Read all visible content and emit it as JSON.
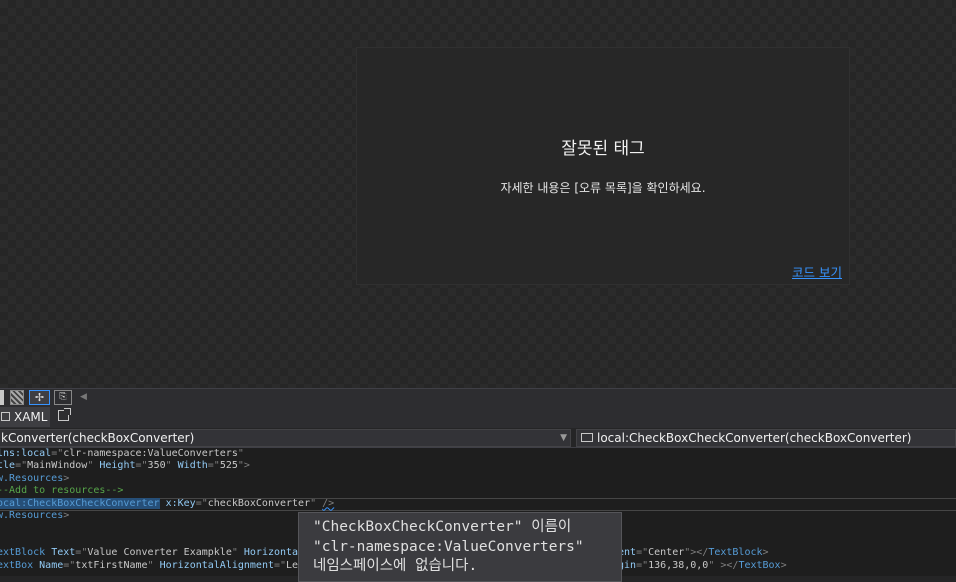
{
  "designer": {
    "error_title": "잘못된 태그",
    "error_message": "자세한 내용은 [오류 목록]을 확인하세요.",
    "view_code_link": "코드 보기"
  },
  "tabs": {
    "xaml_label": "XAML"
  },
  "navigation": {
    "left_combo": "kConverter(checkBoxConverter)",
    "right_combo": "local:CheckBoxCheckConverter(checkBoxConverter)"
  },
  "code_lines": [
    [
      {
        "c": "attr",
        "t": "lns:"
      },
      {
        "c": "attr",
        "t": "local"
      },
      {
        "c": "pct",
        "t": "=\""
      },
      {
        "c": "val",
        "t": "clr-namespace:ValueConverters"
      },
      {
        "c": "pct",
        "t": "\""
      }
    ],
    [
      {
        "c": "attr",
        "t": "tle"
      },
      {
        "c": "pct",
        "t": "=\""
      },
      {
        "c": "val",
        "t": "MainWindow"
      },
      {
        "c": "pct",
        "t": "\" "
      },
      {
        "c": "attr",
        "t": "Height"
      },
      {
        "c": "pct",
        "t": "=\""
      },
      {
        "c": "val",
        "t": "350"
      },
      {
        "c": "pct",
        "t": "\" "
      },
      {
        "c": "attr",
        "t": "Width"
      },
      {
        "c": "pct",
        "t": "=\""
      },
      {
        "c": "val",
        "t": "525"
      },
      {
        "c": "pct",
        "t": "\">"
      }
    ],
    [
      {
        "c": "el",
        "t": "w.Resources"
      },
      {
        "c": "pct",
        "t": ">"
      }
    ],
    [
      {
        "c": "cm",
        "t": "--Add to resources-->"
      }
    ],
    [
      {
        "c": "el sel",
        "t": "ocal:CheckBoxCheckConverter"
      },
      {
        "c": "pct",
        "t": " "
      },
      {
        "c": "attr",
        "t": "x:Key"
      },
      {
        "c": "pct",
        "t": "=\""
      },
      {
        "c": "val",
        "t": "checkBoxConverter"
      },
      {
        "c": "pct",
        "t": "\" "
      },
      {
        "c": "pct squiggle",
        "t": "/>"
      }
    ],
    [
      {
        "c": "el",
        "t": "w.Resources"
      },
      {
        "c": "pct",
        "t": ">"
      }
    ],
    [],
    [],
    [
      {
        "c": "el",
        "t": "extBlock"
      },
      {
        "c": "pct",
        "t": " "
      },
      {
        "c": "attr",
        "t": "Text"
      },
      {
        "c": "pct",
        "t": "=\""
      },
      {
        "c": "val",
        "t": "Value Converter Exampkle"
      },
      {
        "c": "pct",
        "t": "\" "
      },
      {
        "c": "attr",
        "t": "Horizontal"
      }
    ],
    [
      {
        "c": "el",
        "t": "extBox"
      },
      {
        "c": "pct",
        "t": " "
      },
      {
        "c": "attr",
        "t": "Name"
      },
      {
        "c": "pct",
        "t": "=\""
      },
      {
        "c": "val",
        "t": "txtFirstName"
      },
      {
        "c": "pct",
        "t": "\" "
      },
      {
        "c": "attr",
        "t": "HorizontalAlignment"
      },
      {
        "c": "pct",
        "t": "=\""
      },
      {
        "c": "val",
        "t": "Le"
      }
    ]
  ],
  "code_right": [
    {
      "line": 8,
      "tokens": [
        {
          "c": "attr",
          "t": "ent"
        },
        {
          "c": "pct",
          "t": "=\""
        },
        {
          "c": "val",
          "t": "Center"
        },
        {
          "c": "pct",
          "t": "\"></"
        },
        {
          "c": "el",
          "t": "TextBlock"
        },
        {
          "c": "pct",
          "t": ">"
        }
      ]
    },
    {
      "line": 9,
      "tokens": [
        {
          "c": "attr",
          "t": "gin"
        },
        {
          "c": "pct",
          "t": "=\""
        },
        {
          "c": "val",
          "t": "136,38,0,0"
        },
        {
          "c": "pct",
          "t": "\" ></"
        },
        {
          "c": "el",
          "t": "TextBox"
        },
        {
          "c": "pct",
          "t": ">"
        }
      ]
    }
  ],
  "tooltip": {
    "line1": "\"CheckBoxCheckConverter\" 이름이",
    "line2": "\"clr-namespace:ValueConverters\"",
    "line3": "네임스페이스에 없습니다."
  }
}
